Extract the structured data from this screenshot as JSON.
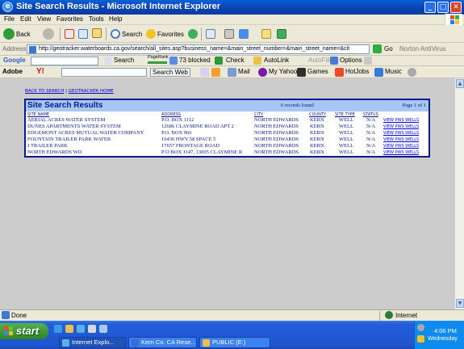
{
  "window": {
    "title": "Site Search Results - Microsoft Internet Explorer",
    "controls": {
      "minimize": "_",
      "maximize": "□",
      "close": "✕"
    }
  },
  "menu": [
    "File",
    "Edit",
    "View",
    "Favorites",
    "Tools",
    "Help"
  ],
  "toolbar": {
    "back": "Back",
    "search": "Search",
    "favorites": "Favorites"
  },
  "address": {
    "label": "Address",
    "url": "http://geotracker.waterboards.ca.gov/search/all_sites.asp?business_name=&main_street_number=&main_street_name=&cit",
    "go": "Go",
    "norton": "Norton AntiVirus"
  },
  "google_bar": {
    "logo": "Google",
    "search": "Search",
    "pagerank": "PageRank",
    "blocked": "73 blocked",
    "check": "Check",
    "autolink": "AutoLink",
    "autofill": "AutoFill",
    "options": "Options"
  },
  "yahoo_bar": {
    "adobe": "Adobe",
    "yahoo": "Y!",
    "search_web": "Search Web",
    "mail": "Mail",
    "my_yahoo": "My Yahoo!",
    "games": "Games",
    "hotjobs": "HotJobs",
    "music": "Music"
  },
  "page": {
    "nav_back": "BACK TO SEARCH",
    "nav_sep": "|",
    "nav_home": "GEOTRACKER HOME",
    "results_title": "Site Search Results",
    "found": "6 records found",
    "pagination": "Page 1 of 1",
    "columns": [
      "SITE NAME",
      "ADDRESS",
      "CITY",
      "COUNTY",
      "SITE TYPE",
      "STATUS"
    ],
    "rows": [
      {
        "site": "AERIAL ACRES WATER SYSTEM",
        "address": "P.O. BOX 1112",
        "city": "NORTH EDWARDS",
        "county": "KERN",
        "type": "WELL",
        "status": "N/A",
        "link": "VIEW PWS WELLS"
      },
      {
        "site": "DUNES APARTMENTS WATER SYSTEM",
        "address": "12686 CLAYMINE ROAD APT 2",
        "city": "NORTH EDWARDS",
        "county": "KERN",
        "type": "WELL",
        "status": "N/A",
        "link": "VIEW PWS WELLS"
      },
      {
        "site": "EDGEMONT ACRES MUTUAL WATER COMPANY",
        "address": "P.O. BOX 966",
        "city": "NORTH EDWARDS",
        "county": "KERN",
        "type": "WELL",
        "status": "N/A",
        "link": "VIEW PWS WELLS"
      },
      {
        "site": "FOUNTAIN TRAILER PARK WATER",
        "address": "16430 HWY 58 SPACE 5",
        "city": "NORTH EDWARDS",
        "county": "KERN",
        "type": "WELL",
        "status": "N/A",
        "link": "VIEW PWS WELLS"
      },
      {
        "site": "J TRAILER PARK",
        "address": "17657 FRONTAGE ROAD",
        "city": "NORTH EDWARDS",
        "county": "KERN",
        "type": "WELL",
        "status": "N/A",
        "link": "VIEW PWS WELLS"
      },
      {
        "site": "NORTH EDWARDS WD",
        "address": "P O BOX 1147, 13005 CLAYMINE R",
        "city": "NORTH EDWARDS",
        "county": "KERN",
        "type": "WELL",
        "status": "N/A",
        "link": "VIEW PWS WELLS"
      }
    ]
  },
  "status": {
    "left": "Done",
    "zone": "Internet"
  },
  "taskbar": {
    "start": "start",
    "buttons": [
      "Internet Explo...",
      "Kern Co. CA Rese...",
      "PUBLIC (E:)"
    ],
    "time": "4:06 PM",
    "day": "Wednesday"
  },
  "colors": {
    "titlebar": "#0a4fc8",
    "results_border": "#0a1a8a",
    "results_header": "#a6c6f4",
    "content_bg": "#cccccc"
  }
}
